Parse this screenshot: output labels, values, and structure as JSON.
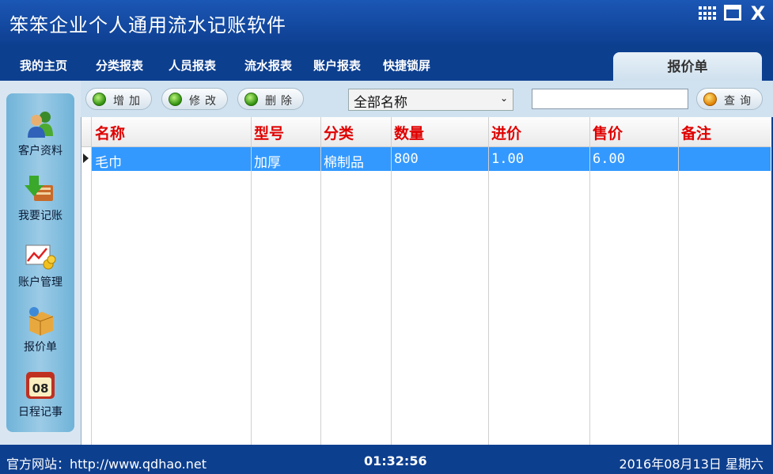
{
  "window": {
    "title": "笨笨企业个人通用流水记账软件"
  },
  "menu": {
    "items": [
      "我的主页",
      "分类报表",
      "人员报表",
      "流水报表",
      "账户报表",
      "快捷锁屏"
    ],
    "active_tab": "报价单"
  },
  "sidebar": {
    "items": [
      {
        "label": "客户资料",
        "icon": "customer-icon"
      },
      {
        "label": "我要记账",
        "icon": "bookkeeping-icon"
      },
      {
        "label": "账户管理",
        "icon": "account-chart-icon"
      },
      {
        "label": "报价单",
        "icon": "quote-box-icon"
      },
      {
        "label": "日程记事",
        "icon": "calendar-icon",
        "badge": "08"
      }
    ]
  },
  "toolbar": {
    "add_label": "增加",
    "edit_label": "修改",
    "delete_label": "删除",
    "filter_selected": "全部名称",
    "search_value": "",
    "query_label": "查询"
  },
  "table": {
    "columns": [
      "名称",
      "型号",
      "分类",
      "数量",
      "进价",
      "售价",
      "备注"
    ],
    "rows": [
      [
        "毛巾",
        "加厚",
        "棉制品",
        "800",
        "1.00",
        "6.00",
        ""
      ]
    ]
  },
  "status": {
    "website": "官方网站：http://www.qdhao.net",
    "time": "01:32:56",
    "date": "2016年08月13日  星期六"
  },
  "colors": {
    "chrome_blue": "#0d3f8f",
    "header_red": "#e00000",
    "selected_row": "#3399ff"
  }
}
